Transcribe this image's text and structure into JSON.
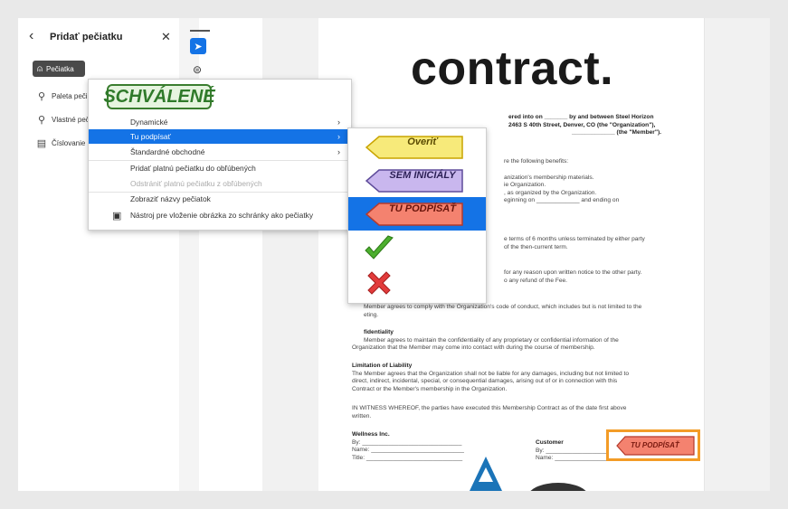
{
  "panel": {
    "title": "Pridať pečiatku",
    "stamps_button": "Pečiatka",
    "items": [
      {
        "label": "Paleta pečiatok"
      },
      {
        "label": "Vlastné pečiatky"
      },
      {
        "label": "Číslovanie Batesa"
      }
    ]
  },
  "stamp_menu": {
    "preview_label": "SCHVÁLENÉ",
    "rows": [
      {
        "label": "Dynamické",
        "submenu": true
      },
      {
        "label": "Tu podpísať",
        "submenu": true
      },
      {
        "label": "Štandardné obchodné",
        "submenu": true
      },
      {
        "label": "Pridať platnú pečiatku do obľúbených"
      },
      {
        "label": "Odstrániť platnú pečiatku z obľúbených"
      },
      {
        "label": "Zobraziť názvy pečiatok"
      },
      {
        "label": "Nástroj pre vloženie obrázka zo schránky ako pečiatky"
      }
    ]
  },
  "sign_submenu": {
    "stamps": [
      {
        "label": "Overiť",
        "fill": "#f7ea7a",
        "stroke": "#c9a400"
      },
      {
        "label": "SEM INICIÁLY",
        "fill": "#c9b7ee",
        "stroke": "#5e4b9a"
      },
      {
        "label": "TU PODPÍSAŤ",
        "fill": "#f4826f",
        "stroke": "#b43a2c"
      }
    ]
  },
  "document": {
    "title": "contract.",
    "intro": [
      "ered into on _______ by and between Steel Horizon",
      "2463 S 40th Street, Denver, CO (the \"Organization\"),",
      "_____________ (the \"Member\")."
    ],
    "benefits": [
      "re the following benefits:",
      "anization's membership materials.",
      "ie Organization.",
      ", as organized by the Organization.",
      "eginning on _____________ and ending on"
    ],
    "term": [
      "e terms of 6 months unless terminated by either party",
      "of the then-current term."
    ],
    "termination": [
      "for any reason upon written notice to the other party.",
      "o any refund of the Fee."
    ],
    "conduct": [
      "Member agrees to comply with the Organization's code of conduct, which includes but is not limited to the",
      "eting."
    ],
    "confidentiality_heading": "fidentiality",
    "confidentiality": [
      "Member agrees to maintain the confidentiality of any proprietary or confidential information of the",
      "Organization that the Member may come into contact with during the course of membership."
    ],
    "liability_heading": "Limitation of Liability",
    "liability": [
      "The Member agrees that the Organization shall not be liable for any damages, including but not limited to",
      "direct, indirect, incidental, special, or consequential damages, arising out of or in connection with this",
      "Contract or the Member's membership in the Organization."
    ],
    "witness": [
      "IN WITNESS WHEREOF, the parties have executed this Membership Contract as of the date first above",
      "written."
    ],
    "left_party": "Wellness Inc.",
    "right_party": "Customer",
    "sig_lines_left": [
      "By: ______________________________",
      "Name: ____________________________",
      "Title: _____________________________"
    ],
    "sig_lines_right": [
      "By: ______________________",
      "Name: ____________________"
    ],
    "placed_stamp": "TU PODPÍSAŤ"
  },
  "colors": {
    "accent": "#1473e6",
    "highlight_box": "#f39c27"
  }
}
